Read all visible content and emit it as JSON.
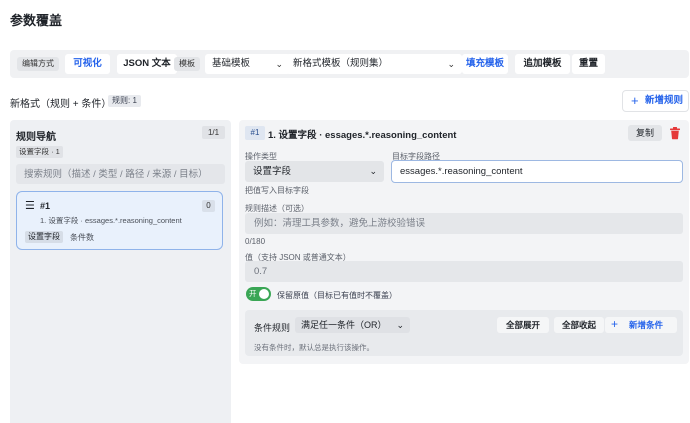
{
  "page_title": "参数覆盖",
  "toolbar": {
    "edit_mode_label": "编辑方式",
    "visual_btn": "可视化",
    "json_btn": "JSON 文本",
    "template_label": "模板",
    "template_select": "基础模板",
    "format_select": "新格式模板（规则集）",
    "fill_btn": "填充模板",
    "append_btn": "追加模板",
    "reset_btn": "重置"
  },
  "subheader": {
    "label": "新格式（规则 + 条件）",
    "rule_count": "规则: 1",
    "add_rule": "新增规则",
    "add_rule_icon": "plus-icon"
  },
  "nav": {
    "title": "规则导航",
    "page": "1/1",
    "filter_tag": "设置字段 · 1",
    "search_placeholder": "搜索规则（描述 / 类型 / 路径 / 来源 / 目标）",
    "rules": [
      {
        "id": "#1",
        "count": "0",
        "desc": "1. 设置字段 · essages.*.reasoning_content",
        "tag": "设置字段",
        "cond": "条件数",
        "icon": "drag-handle-icon"
      }
    ]
  },
  "detail": {
    "badge": "#1",
    "title": "1. 设置字段 · essages.*.reasoning_content",
    "copy_btn": "复制",
    "delete_icon": "trash-icon",
    "delete_color": "#e5393a",
    "op_type_label": "操作类型",
    "op_type_value": "设置字段",
    "target_path_label": "目标字段路径",
    "target_path_value": "essages.*.reasoning_content",
    "op_hint": "把值写入目标字段",
    "desc_label": "规则描述（可选）",
    "desc_placeholder": "例如：清理工具参数，避免上游校验错误",
    "desc_counter": "0/180",
    "value_label": "值（支持 JSON 或普通文本）",
    "value_value": "0.7",
    "toggle_on_text": "开",
    "toggle_label": "保留原值（目标已有值时不覆盖）",
    "toggle_color": "#3aa655",
    "cond_label": "条件规则",
    "cond_select": "满足任一条件（OR）",
    "expand_all": "全部展开",
    "collapse_all": "全部收起",
    "add_cond": "新增条件",
    "cond_empty": "没有条件时，默认总是执行该操作。"
  },
  "colors": {
    "accent": "#2563eb"
  }
}
